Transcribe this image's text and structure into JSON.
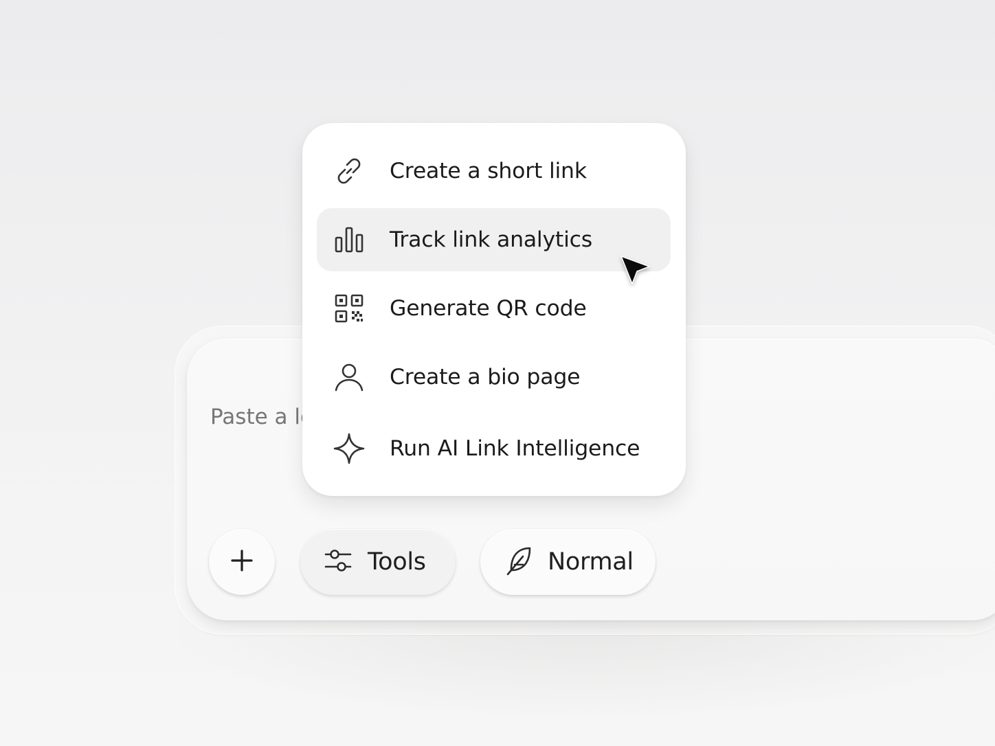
{
  "composer": {
    "placeholder": "Paste a long URL",
    "plus_icon": "plus-icon",
    "tools_label": "Tools",
    "tools_icon": "sliders-icon",
    "mode_label": "Normal",
    "mode_icon": "feather-icon"
  },
  "menu": {
    "items": [
      {
        "label": "Create a short link",
        "icon": "link-icon"
      },
      {
        "label": "Track link analytics",
        "icon": "bar-chart-icon",
        "highlighted": true
      },
      {
        "label": "Generate QR code",
        "icon": "qr-code-icon"
      },
      {
        "label": "Create a bio page",
        "icon": "user-icon"
      },
      {
        "label": "Run AI Link Intelligence",
        "icon": "sparkle-icon"
      }
    ]
  },
  "colors": {
    "background": "#efeff0",
    "surface": "#f8f8f8",
    "menu": "#ffffff",
    "highlight": "#f0f0f0",
    "text": "#1b1b1b",
    "placeholder": "#767676"
  }
}
